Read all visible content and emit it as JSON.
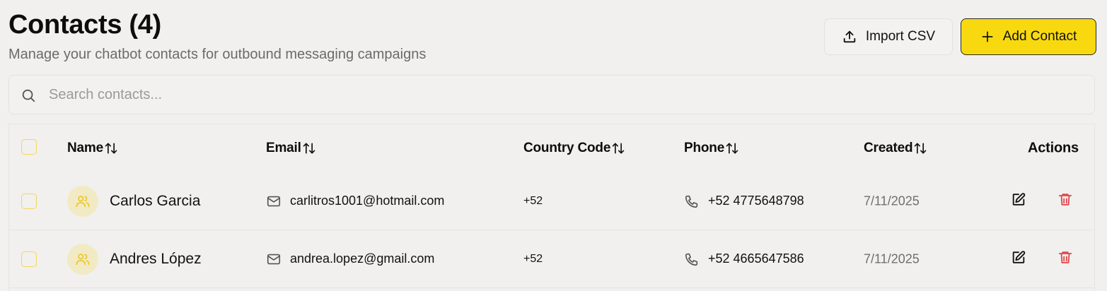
{
  "header": {
    "title": "Contacts (4)",
    "subtitle": "Manage your chatbot contacts for outbound messaging campaigns",
    "import_label": "Import CSV",
    "add_label": "Add Contact"
  },
  "search": {
    "placeholder": "Search contacts...",
    "value": ""
  },
  "table": {
    "columns": {
      "name": "Name",
      "email": "Email",
      "country_code": "Country Code",
      "phone": "Phone",
      "created": "Created",
      "actions": "Actions"
    },
    "rows": [
      {
        "name": "Carlos Garcia",
        "email": "carlitros1001@hotmail.com",
        "country_code": "+52",
        "phone": "+52 4775648798",
        "created": "7/11/2025"
      },
      {
        "name": "Andres López",
        "email": "andrea.lopez@gmail.com",
        "country_code": "+52",
        "phone": "+52 4665647586",
        "created": "7/11/2025"
      }
    ]
  },
  "colors": {
    "accent": "#f8d90f",
    "checkbox_border": "#f1d75c",
    "avatar_bg": "#f1eac4",
    "avatar_icon": "#e9c62b",
    "delete": "#e0474c",
    "background": "#f1f0ee"
  },
  "icons": {
    "import": "upload-icon",
    "add": "plus-icon",
    "search": "search-icon",
    "sort": "sort-arrows-icon",
    "avatar": "users-icon",
    "email": "mail-icon",
    "phone": "phone-icon",
    "edit": "edit-icon",
    "delete": "trash-icon"
  }
}
